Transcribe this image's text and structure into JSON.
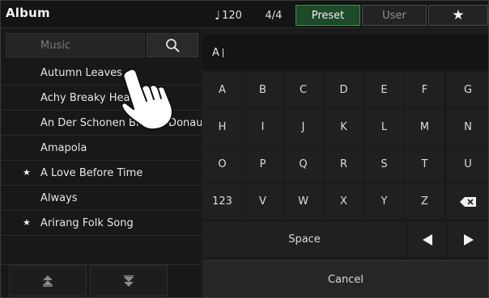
{
  "header": {
    "title": "Album",
    "tempo_icon": "♩",
    "tempo": "120",
    "time_signature": "4/4",
    "tabs": [
      {
        "label": "Preset",
        "active": true
      },
      {
        "label": "User",
        "active": false
      }
    ],
    "favorite_icon": "★"
  },
  "search": {
    "placeholder": "Music",
    "icon": "search-icon"
  },
  "songs": [
    {
      "title": "Autumn Leaves",
      "favorite": false
    },
    {
      "title": "Achy Breaky Heart",
      "favorite": false
    },
    {
      "title": "An Der Schonen Blauen Donau",
      "favorite": false
    },
    {
      "title": "Amapola",
      "favorite": false
    },
    {
      "title": "A Love Before Time",
      "favorite": true
    },
    {
      "title": "Always",
      "favorite": false
    },
    {
      "title": "Arirang Folk Song",
      "favorite": true
    }
  ],
  "favorite_marker": "★",
  "scroll": {
    "top_icon": "double-up-arrow-icon",
    "bottom_icon": "double-down-arrow-icon"
  },
  "keyboard": {
    "input_text": "A",
    "rows": [
      [
        "A",
        "B",
        "C",
        "D",
        "E",
        "F",
        "G"
      ],
      [
        "H",
        "I",
        "J",
        "K",
        "L",
        "M",
        "N"
      ],
      [
        "O",
        "P",
        "Q",
        "R",
        "S",
        "T",
        "U"
      ],
      [
        "123",
        "V",
        "W",
        "X",
        "Y",
        "Z",
        "backspace-icon"
      ]
    ],
    "space_label": "Space",
    "left_icon": "left-arrow-icon",
    "right_icon": "right-arrow-icon",
    "cancel_label": "Cancel"
  },
  "colors": {
    "background": "#1e1e1e",
    "active_tab": "#1f4a2a",
    "active_tab_border": "#3f8a55"
  }
}
